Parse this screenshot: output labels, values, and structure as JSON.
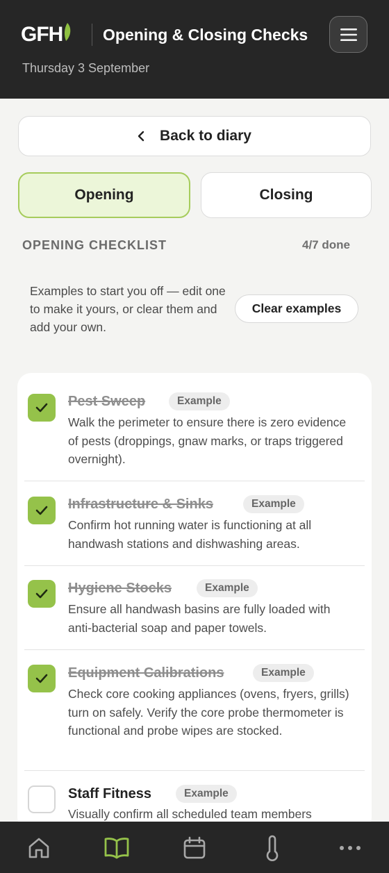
{
  "header": {
    "logo_text": "GFH",
    "title": "Opening & Closing Checks",
    "date": "Thursday 3 September",
    "menu_icon": "hamburger-icon"
  },
  "back_button": {
    "label": "Back to diary",
    "icon": "chevron-left-icon"
  },
  "tabs": [
    {
      "label": "Opening",
      "active": true
    },
    {
      "label": "Closing",
      "active": false
    }
  ],
  "checklist": {
    "title": "OPENING CHECKLIST",
    "progress": "4/7 done",
    "examples_note": "Examples to start you off — edit one to make it yours, or clear them and add your own.",
    "clear_label": "Clear examples",
    "items": [
      {
        "title": "Pest Sweep",
        "badge": "Example",
        "checked": true,
        "description": "Walk the perimeter to ensure there is zero evidence of pests (droppings, gnaw marks, or traps triggered overnight)."
      },
      {
        "title": "Infrastructure & Sinks",
        "badge": "Example",
        "checked": true,
        "description": "Confirm hot running water is functioning at all handwash stations and dishwashing areas."
      },
      {
        "title": "Hygiene Stocks",
        "badge": "Example",
        "checked": true,
        "description": "Ensure all handwash basins are fully loaded with anti-bacterial soap and paper towels."
      },
      {
        "title": "Equipment Calibrations",
        "badge": "Example",
        "checked": true,
        "description": "Check core cooking appliances (ovens, fryers, grills) turn on safely. Verify the core probe thermometer is functional and probe wipes are stocked."
      },
      {
        "title": "Staff Fitness",
        "badge": "Example",
        "checked": false,
        "description": "Visually confirm all scheduled team members"
      }
    ]
  },
  "bottom_nav": [
    {
      "icon": "home-icon",
      "active": false
    },
    {
      "icon": "book-icon",
      "active": true
    },
    {
      "icon": "calendar-icon",
      "active": false
    },
    {
      "icon": "thermometer-icon",
      "active": false
    },
    {
      "icon": "more-icon",
      "active": false
    }
  ],
  "colors": {
    "accent": "#95c24a",
    "header_bg": "#262626",
    "tab_active_bg": "#ecf6d9"
  }
}
